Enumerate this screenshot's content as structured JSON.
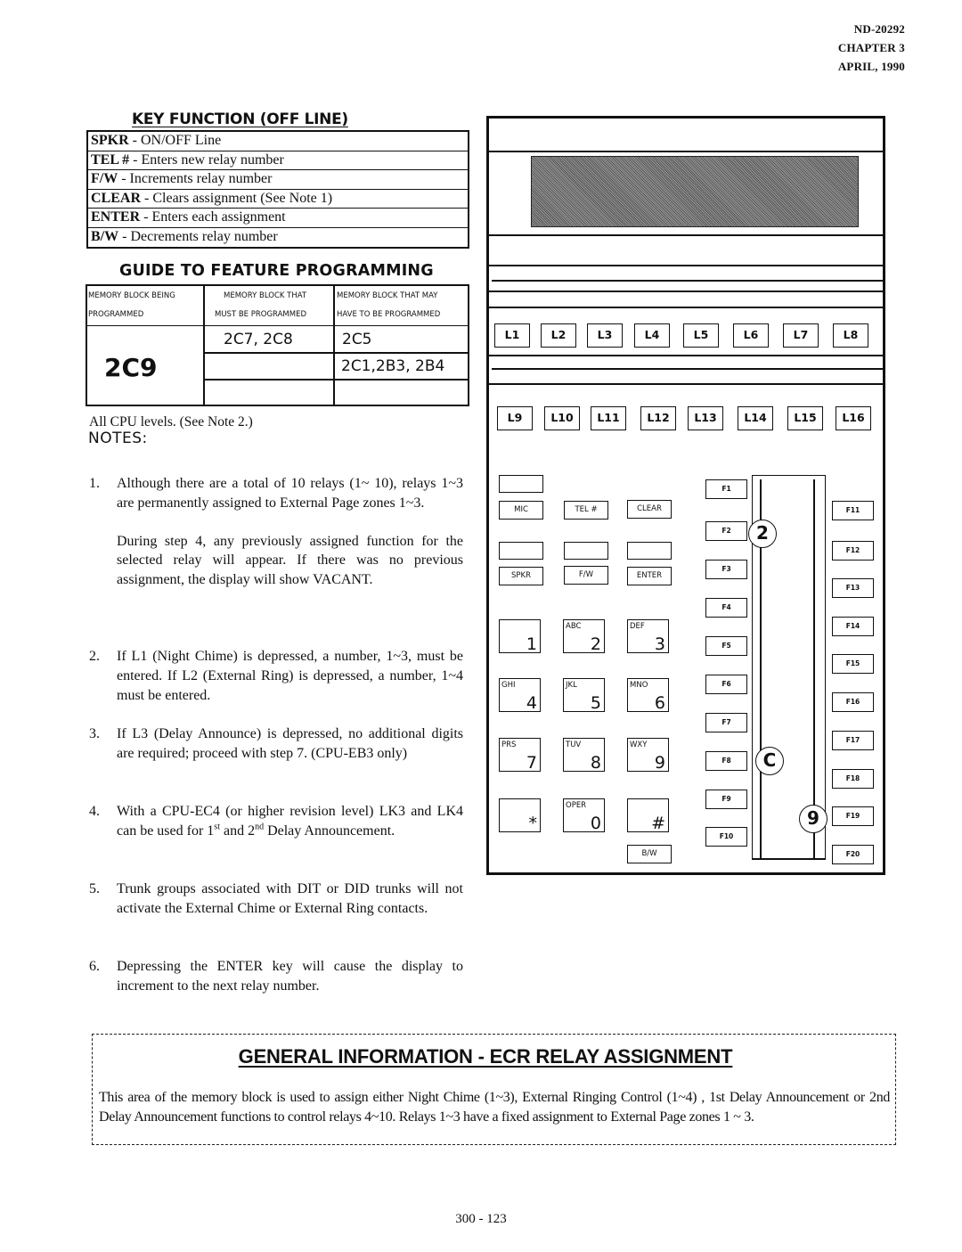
{
  "header": {
    "doc_number": "ND-20292",
    "chapter": "CHAPTER 3",
    "date": "APRIL, 1990"
  },
  "key_function": {
    "title": "KEY FUNCTION (OFF LINE)",
    "rows": [
      {
        "key": "SPKR",
        "sep": " - ",
        "desc": "ON/OFF Line"
      },
      {
        "key": "TEL #",
        "sep": " - ",
        "desc": " Enters new relay number"
      },
      {
        "key": "F/W",
        "sep": " - ",
        "desc": " Increments relay number"
      },
      {
        "key": "CLEAR",
        "sep": " - ",
        "desc": " Clears assignment  (See Note 1)"
      },
      {
        "key": "ENTER",
        "sep": " - ",
        "desc": "  Enters each assignment"
      },
      {
        "key": "B/W",
        "sep": " - ",
        "desc": "Decrements relay number"
      }
    ]
  },
  "guide": {
    "title": "GUIDE TO FEATURE PROGRAMMING",
    "headers": [
      [
        "MEMORY BLOCK BEING",
        "PROGRAMMED"
      ],
      [
        "MEMORY BLOCK THAT",
        "MUST BE PROGRAMMED"
      ],
      [
        "MEMORY BLOCK THAT MAY",
        "HAVE TO BE PROGRAMMED"
      ]
    ],
    "block_programmed": "2C9",
    "must_be_programmed": [
      "2C7,  2C8",
      "",
      ""
    ],
    "may_have_to_be_programmed": [
      "2C5",
      "2C1,2B3, 2B4",
      ""
    ],
    "cpu_levels": "All CPU levels.  (See Note 2.)"
  },
  "notes": {
    "heading": "NOTES:",
    "items": [
      {
        "num": "1.",
        "paragraphs": [
          "Although there are a total of 10 relays  (1~ 10), relays 1~3 are permanently assigned to External Page zones  1~3.",
          "During step 4, any previously assigned function for the selected relay will appear.  If there was no previous assignment, the display will show VACANT."
        ]
      },
      {
        "num": "2.",
        "paragraphs": [
          "If L1 (Night Chime) is depressed, a number, 1~3, must be entered.  If L2 (External Ring) is depressed, a number, 1~4 must be entered."
        ]
      },
      {
        "num": "3.",
        "paragraphs": [
          "If L3 (Delay Announce) is depressed, no additional digits are required; proceed with step 7.  (CPU-EB3 only)"
        ]
      },
      {
        "num": "4.",
        "pre": "With a CPU-EC4 (or higher revision level) LK3 and LK4 can be used for 1",
        "sup1": "st",
        "mid": " and 2",
        "sup2": "nd",
        "post": " Delay Announcement."
      },
      {
        "num": "5.",
        "paragraphs": [
          "Trunk groups associated with DIT or DID trunks will not activate the External Chime or External Ring contacts."
        ]
      },
      {
        "num": "6.",
        "paragraphs": [
          "Depressing the ENTER key will cause the display to increment to the next relay number."
        ]
      }
    ]
  },
  "phone": {
    "line_keys_row1": [
      "L1",
      "L2",
      "L3",
      "L4",
      "L5",
      "L6",
      "L7",
      "L8"
    ],
    "line_keys_row2": [
      "L9",
      "L10",
      "L11",
      "L12",
      "L13",
      "L14",
      "L15",
      "L16"
    ],
    "function_keys": {
      "mic": "MIC",
      "tel": "TEL #",
      "clear": "CLEAR",
      "spkr": "SPKR",
      "fw": "F/W",
      "enter": "ENTER",
      "bw": "B/W"
    },
    "dialpad": [
      {
        "letters": "",
        "digit": "1"
      },
      {
        "letters": "ABC",
        "digit": "2"
      },
      {
        "letters": "DEF",
        "digit": "3"
      },
      {
        "letters": "GHI",
        "digit": "4"
      },
      {
        "letters": "JKL",
        "digit": "5"
      },
      {
        "letters": "MNO",
        "digit": "6"
      },
      {
        "letters": "PRS",
        "digit": "7"
      },
      {
        "letters": "TUV",
        "digit": "8"
      },
      {
        "letters": "WXY",
        "digit": "9"
      },
      {
        "letters": "",
        "digit": "*"
      },
      {
        "letters": "OPER",
        "digit": "0"
      },
      {
        "letters": "",
        "digit": "#"
      }
    ],
    "f_keys_left": [
      "F1",
      "F2",
      "F3",
      "F4",
      "F5",
      "F6",
      "F7",
      "F8",
      "F9",
      "F10"
    ],
    "f_keys_right": [
      "F11",
      "F12",
      "F13",
      "F14",
      "F15",
      "F16",
      "F17",
      "F18",
      "F19",
      "F20"
    ],
    "callouts": [
      "2",
      "C",
      "9"
    ]
  },
  "general_info": {
    "title": "GENERAL INFORMATION  -  ECR RELAY  ASSIGNMENT",
    "body": "This area of the memory block is used to assign either Night Chime (1~3), External Ringing Control (1~4) , 1st Delay Announcement or 2nd Delay Announcement functions to control relays 4~10.  Relays 1~3 have a fixed assignment to External Page zones 1 ~ 3."
  },
  "page_number": "300 - 123"
}
